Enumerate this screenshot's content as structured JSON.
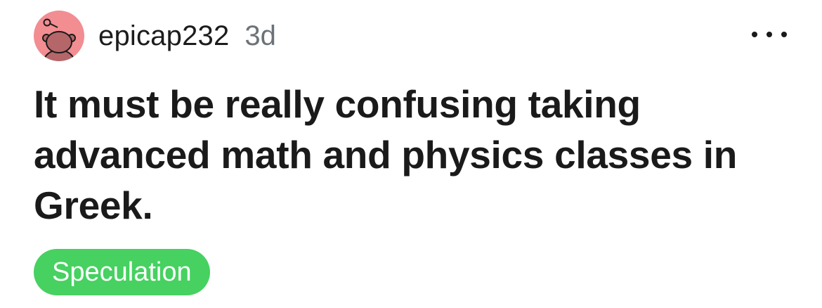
{
  "post": {
    "author": "epicap232",
    "age": "3d",
    "title": "It must be really confusing taking advanced math and physics classes in Greek.",
    "flair": {
      "label": "Speculation",
      "color": "#46d160"
    },
    "avatar_color": "#f28d92",
    "more_icon": "more-horizontal-icon"
  }
}
